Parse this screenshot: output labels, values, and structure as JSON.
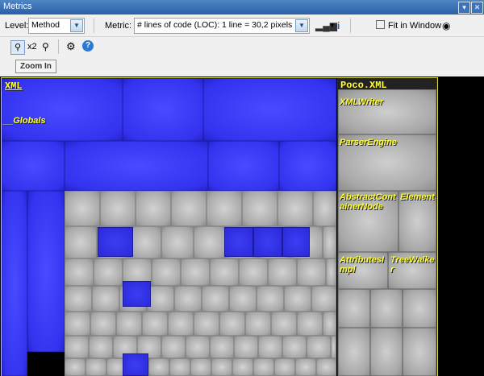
{
  "window": {
    "title": "Metrics",
    "pin_icon": "pin-icon",
    "close_icon": "close-icon"
  },
  "toolbar": {
    "level_label": "Level:",
    "level_value": "Method",
    "metric_label": "Metric:",
    "metric_value": "# lines of code (LOC):  1 line = 30,2 pixels",
    "fit_label": "Fit in Window"
  },
  "zoom": {
    "multiplier": "x2",
    "tooltip": "Zoom In"
  },
  "treemap": {
    "left_title": "XML",
    "globals": "__Globals",
    "right_title": "Poco.XML",
    "labels": [
      "XMLWriter",
      "ParserEngine",
      "AbstractContainerNode",
      "Element",
      "AttributesImpl",
      "TreeWalker"
    ]
  },
  "colors": {
    "highlight": "#3333f0",
    "label": "#ffff33",
    "border": "#d9d940"
  }
}
